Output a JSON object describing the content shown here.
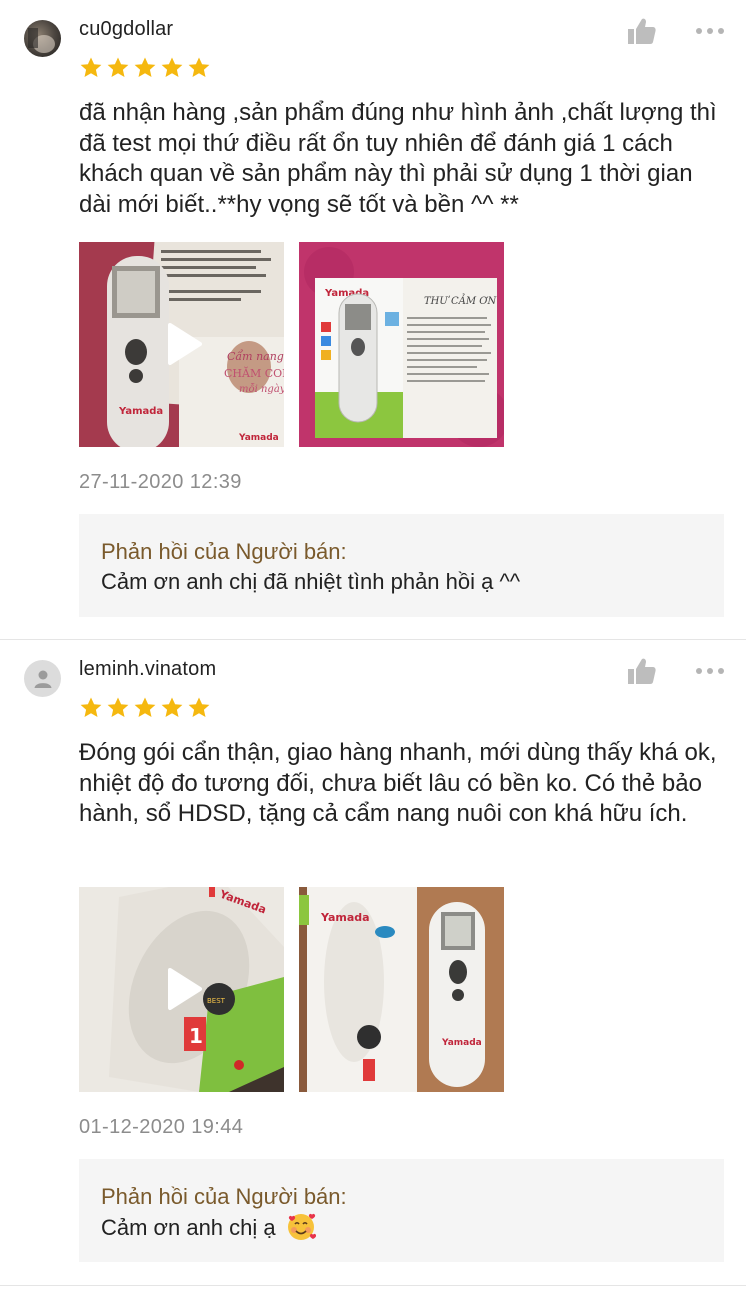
{
  "reviews": [
    {
      "username": "cu0gdollar",
      "rating": 5,
      "comment": "đã nhận hàng ,sản phẩm đúng như hình ảnh ,chất lượng thì đã test mọi thứ điều rất ổn tuy nhiên để đánh giá 1 cách khách quan về sản phẩm này thì phải sử dụng 1 thời gian dài mới biết..**hy vọng sẽ tốt và bền ^^ **",
      "date": "27-11-2020 12:39",
      "seller_reply_title": "Phản hồi của Người bán:",
      "seller_reply_text": "Cảm ơn anh chị đã nhiệt tình phản hồi ạ ^^",
      "media": [
        {
          "type": "video",
          "icon": "play-icon",
          "brand": "Yamada",
          "caption": "Cẩm nang chăm con mỗi ngày"
        },
        {
          "type": "image",
          "brand": "Yamada",
          "caption": "THƯ CẢM ƠN"
        }
      ]
    },
    {
      "username": "leminh.vinatom",
      "rating": 5,
      "comment": "Đóng gói cẩn thận, giao hàng nhanh, mới dùng thấy khá ok, nhiệt độ đo tương đối, chưa biết lâu có bền ko. Có thẻ bảo hành, sổ HDSD, tặng cả cẩm nang nuôi con khá hữu ích.",
      "date": "01-12-2020 19:44",
      "seller_reply_title": "Phản hồi của Người bán:",
      "seller_reply_text": "Cảm ơn anh chị ạ",
      "seller_reply_emoji": "smiling-face-with-hearts-icon",
      "media": [
        {
          "type": "video",
          "icon": "play-icon",
          "brand": "Yamada"
        },
        {
          "type": "image",
          "brand": "Yamada"
        }
      ]
    }
  ],
  "colors": {
    "star": "#f5b80f",
    "seller_title": "#7a5a2c",
    "date": "#8c8c8c",
    "reply_bg": "#f5f5f5"
  }
}
